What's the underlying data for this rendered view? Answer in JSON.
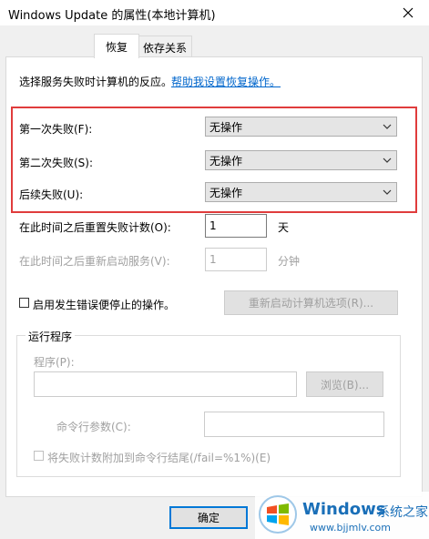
{
  "window": {
    "title": "Windows Update 的属性(本地计算机)"
  },
  "tabs": [
    {
      "label": "恢复"
    },
    {
      "label": "依存关系"
    }
  ],
  "intro": {
    "text": "选择服务失败时计算机的反应。",
    "help_link": "帮助我设置恢复操作。"
  },
  "failures": {
    "first": {
      "label": "第一次失败(F):",
      "value": "无操作"
    },
    "second": {
      "label": "第二次失败(S):",
      "value": "无操作"
    },
    "subsequent": {
      "label": "后续失败(U):",
      "value": "无操作"
    }
  },
  "reset": {
    "label": "在此时间之后重置失败计数(O):",
    "value": "1",
    "unit": "天"
  },
  "restart": {
    "label": "在此时间之后重新启动服务(V):",
    "value": "1",
    "unit": "分钟"
  },
  "stop_actions": {
    "label": "启用发生错误便停止的操作。",
    "button": "重新启动计算机选项(R)..."
  },
  "run_program": {
    "group_label": "运行程序",
    "program_label": "程序(P):",
    "browse_button": "浏览(B)...",
    "params_label": "命令行参数(C):",
    "append_label": "将失败计数附加到命令行结尾(/fail=%1%)(E)"
  },
  "footer": {
    "ok": "确定"
  },
  "watermark": {
    "brand": "Windows",
    "suffix": "系统之家",
    "url": "www.bjjmlv.com"
  }
}
